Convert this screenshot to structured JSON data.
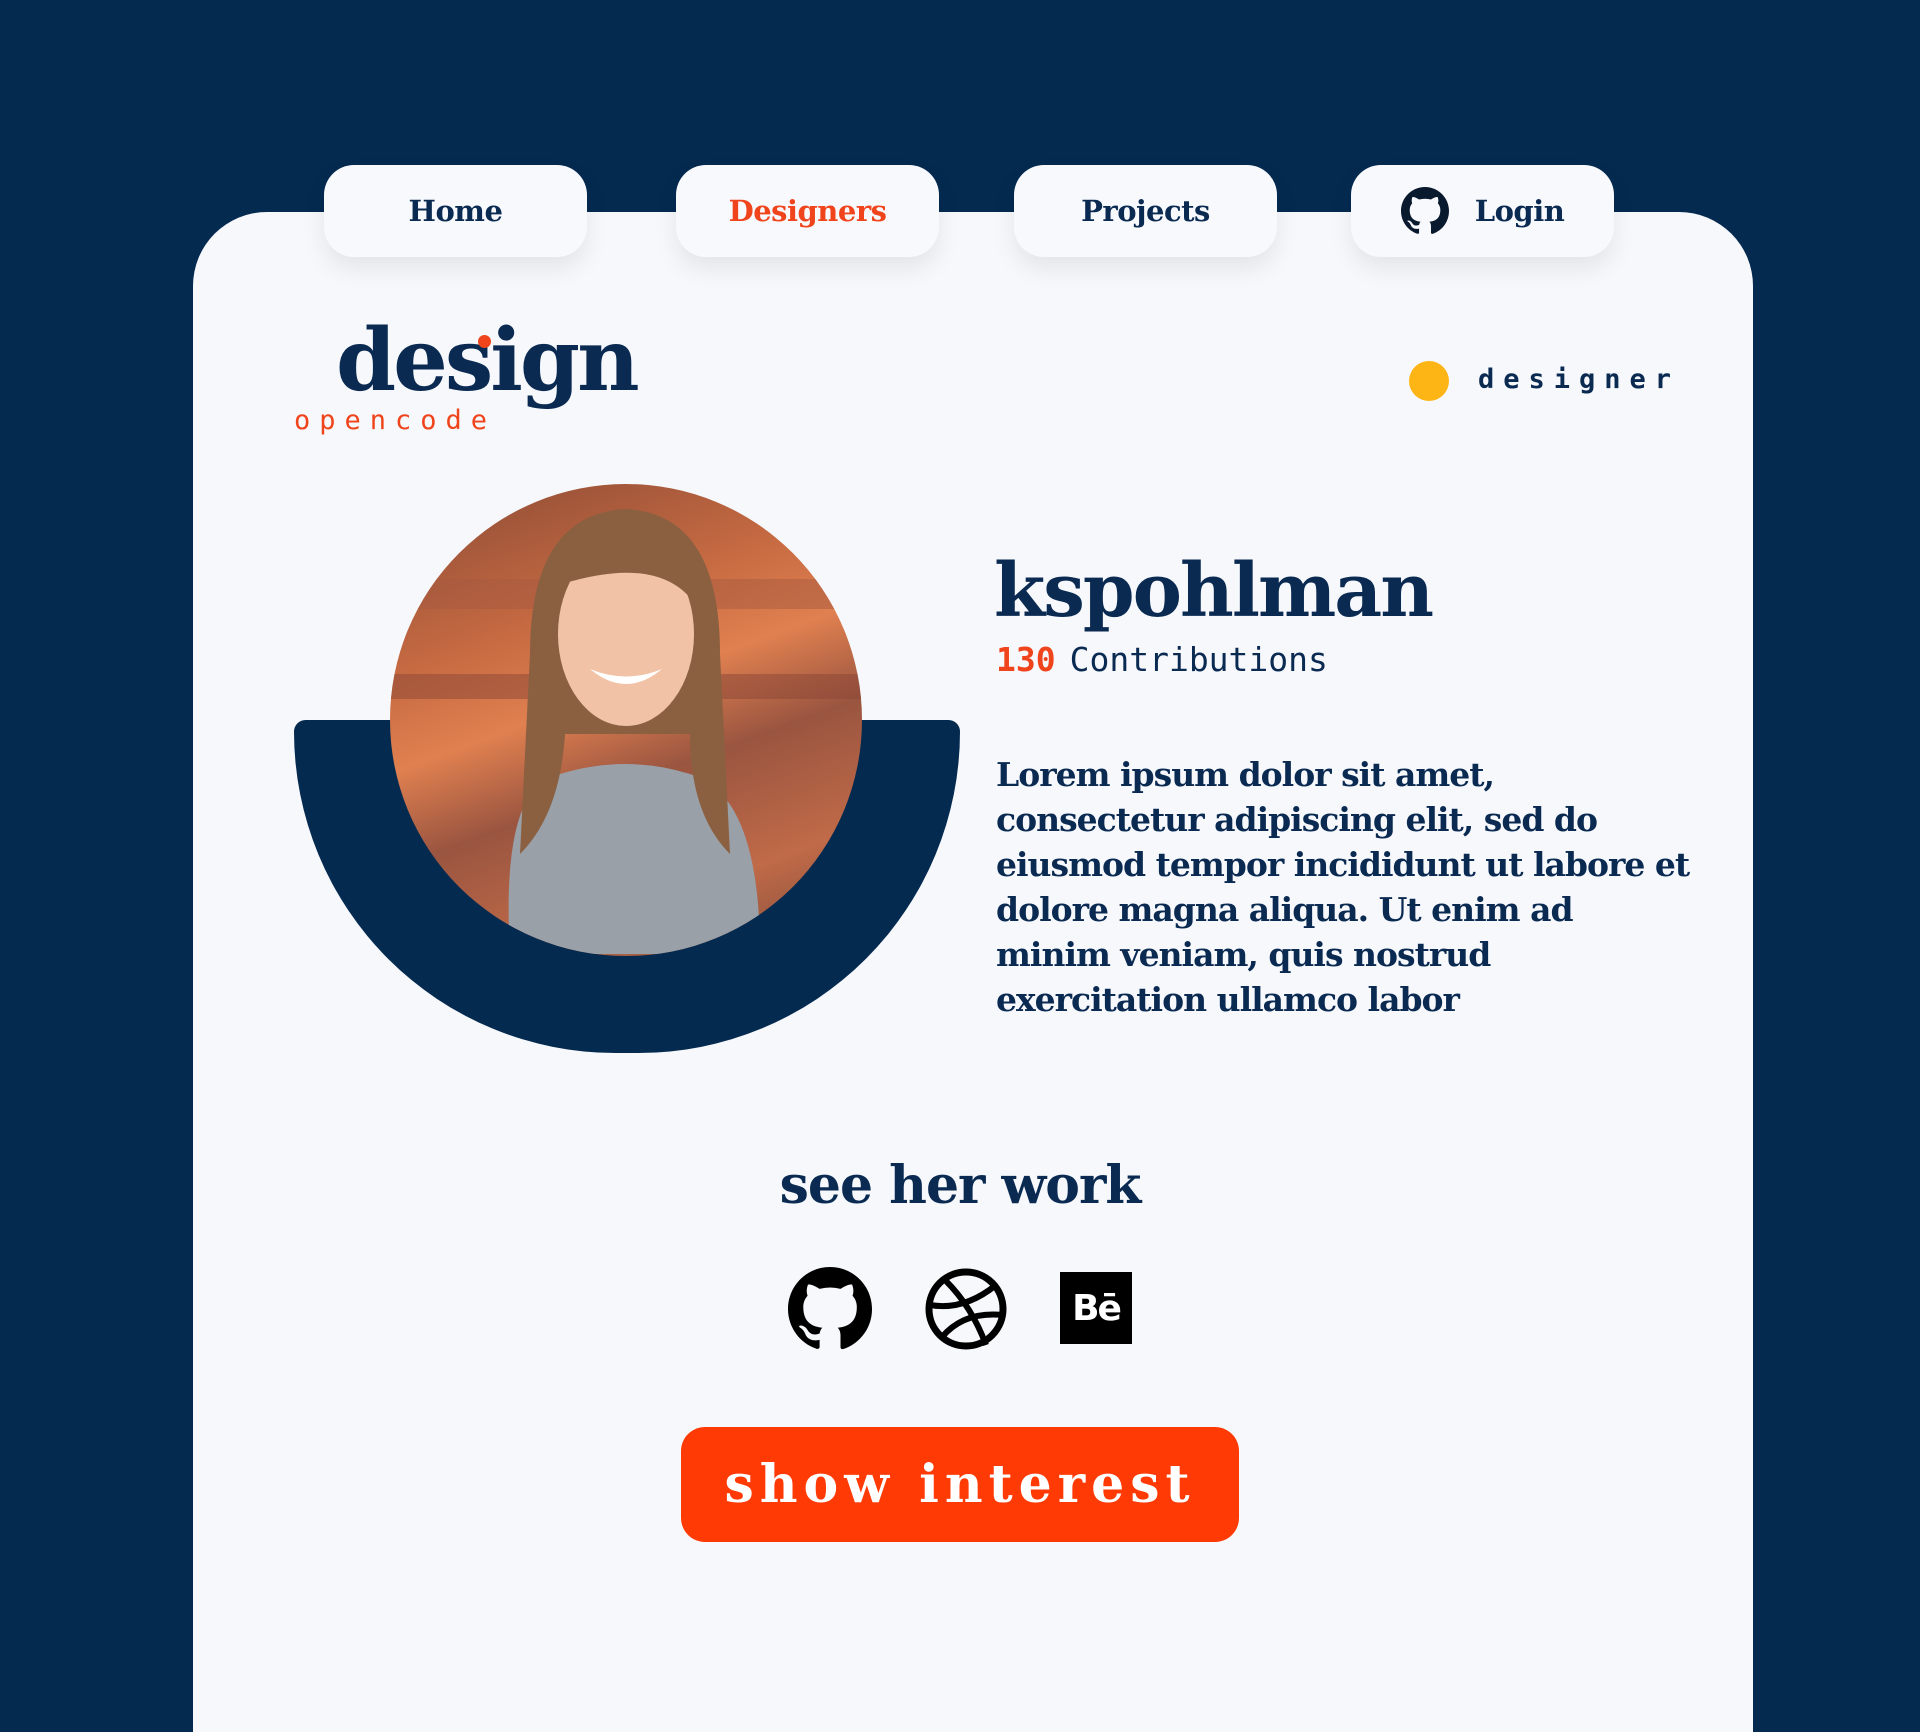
{
  "nav": {
    "tabs": [
      {
        "label": "Home",
        "active": false
      },
      {
        "label": "Designers",
        "active": true
      },
      {
        "label": "Projects",
        "active": false
      },
      {
        "label": "Login",
        "icon": "github-icon",
        "active": false
      }
    ]
  },
  "logo": {
    "main": "design",
    "sub": "opencode"
  },
  "role": {
    "label": "designer",
    "dot_color": "#fdb515"
  },
  "profile": {
    "username": "kspohlman",
    "contributions_count": "130",
    "contributions_label": "Contributions",
    "bio": "Lorem ipsum dolor sit amet, consectetur adipiscing elit, sed do eiusmod tempor incididunt ut labore et dolore magna aliqua. Ut enim ad minim veniam, quis nostrud exercitation ullamco labor"
  },
  "work": {
    "heading": "see her work",
    "links": [
      "github-icon",
      "dribbble-icon",
      "behance-icon"
    ],
    "behance_text": "Bē"
  },
  "cta": {
    "label": "show interest"
  },
  "colors": {
    "navy": "#052a50",
    "accent": "#ff3a05",
    "yellow": "#fdb515",
    "card": "#f6f8fc"
  }
}
